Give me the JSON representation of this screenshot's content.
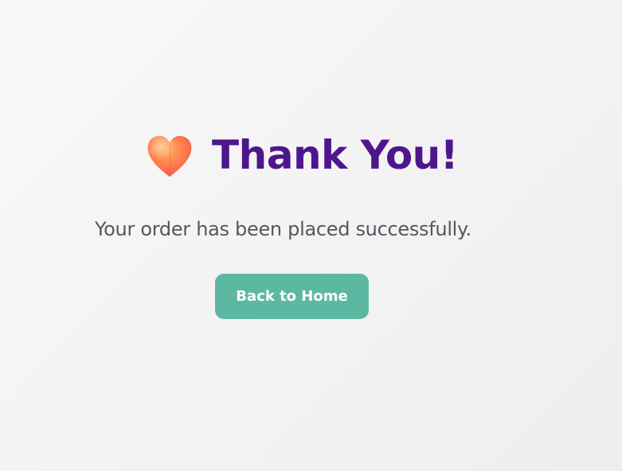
{
  "heading": {
    "icon": "heart-icon",
    "title": "Thank You!"
  },
  "message": "Your order has been placed successfully.",
  "actions": {
    "home_label": "Back to Home"
  },
  "colors": {
    "title": "#4e168c",
    "button": "#5db8a2",
    "message": "#55575c",
    "heart_light": "#ff9a4d",
    "heart_dark": "#f25b57"
  }
}
